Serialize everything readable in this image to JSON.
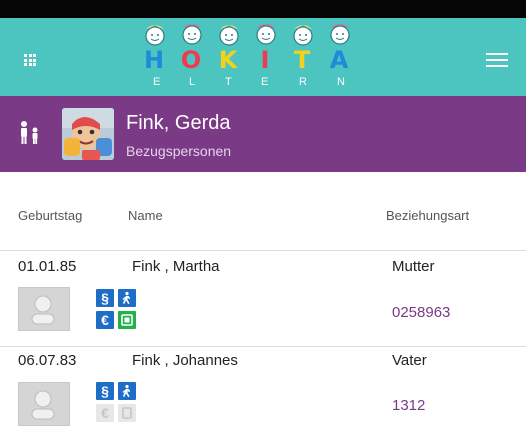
{
  "app": {
    "logo": {
      "main_letters": [
        "H",
        "O",
        "K",
        "I",
        "T",
        "A"
      ],
      "sub_letters": [
        "E",
        "L",
        "T",
        "E",
        "R",
        "N"
      ]
    },
    "icons": {
      "apps": "grid-icon",
      "menu": "hamburger-menu-icon"
    }
  },
  "profile": {
    "name": "Fink, Gerda",
    "subtitle": "Bezugspersonen",
    "icon": "family-icon"
  },
  "table": {
    "headers": {
      "birthday": "Geburtstag",
      "name": "Name",
      "relation": "Beziehungsart"
    },
    "rows": [
      {
        "birthday": "01.01.85",
        "name": "Fink , Martha",
        "relation": "Mutter",
        "phone": "0258963",
        "icons": [
          "paragraph-icon",
          "walking-person-icon",
          "euro-icon",
          "phone-card-icon"
        ]
      },
      {
        "birthday": "06.07.83",
        "name": "Fink , Johannes",
        "relation": "Vater",
        "phone": "1312",
        "icons": [
          "paragraph-icon",
          "walking-person-icon",
          "euro-icon-disabled",
          "phone-card-icon-disabled"
        ]
      }
    ]
  },
  "colors": {
    "appbar": "#4cc5c0",
    "profile": "#7a3a85",
    "blue_icon": "#1e6ec8",
    "green_icon": "#22b04b"
  }
}
